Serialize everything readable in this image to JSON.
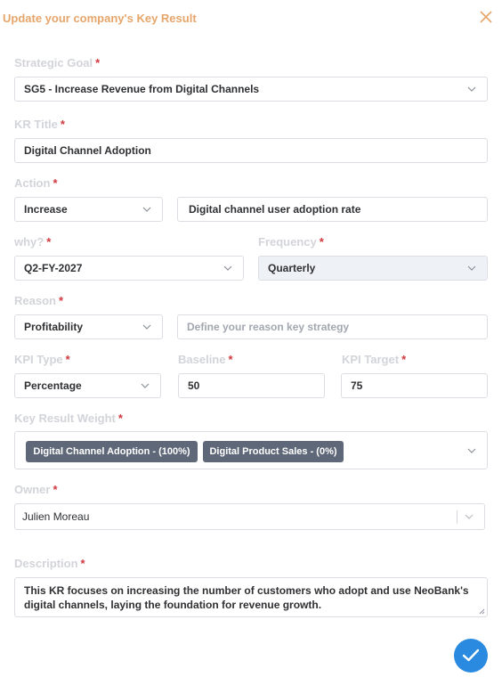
{
  "header": {
    "title": "Update your company's Key Result",
    "close_icon": "close-icon"
  },
  "form": {
    "strategic_goal": {
      "label": "Strategic Goal",
      "value": "SG5 - Increase Revenue from Digital Channels"
    },
    "kr_title": {
      "label": "KR Title",
      "value": "Digital Channel Adoption"
    },
    "action": {
      "label": "Action",
      "select_value": "Increase",
      "text_value": "Digital channel user adoption rate"
    },
    "why": {
      "label": "why?",
      "value": "Q2-FY-2027"
    },
    "frequency": {
      "label": "Frequency",
      "value": "Quarterly"
    },
    "reason": {
      "label": "Reason",
      "select_value": "Profitability",
      "placeholder": "Define your reason key strategy"
    },
    "kpi_type": {
      "label": "KPI Type",
      "value": "Percentage"
    },
    "baseline": {
      "label": "Baseline",
      "value": "50"
    },
    "kpi_target": {
      "label": "KPI Target",
      "value": "75"
    },
    "key_result_weight": {
      "label": "Key Result Weight",
      "chips": [
        "Digital Channel Adoption - (100%)",
        "Digital Product Sales - (0%)"
      ]
    },
    "owner": {
      "label": "Owner",
      "value": "Julien Moreau"
    },
    "description": {
      "label": "Description",
      "value": "This KR focuses on increasing the number of customers who adopt and use NeoBank's digital channels, laying the foundation for revenue growth."
    },
    "required_marker": "*"
  },
  "colors": {
    "title": "#e6a56b",
    "required": "#d0393f",
    "submit": "#2a8ae0",
    "chip": "#5f6878"
  },
  "submit_icon": "check-icon"
}
